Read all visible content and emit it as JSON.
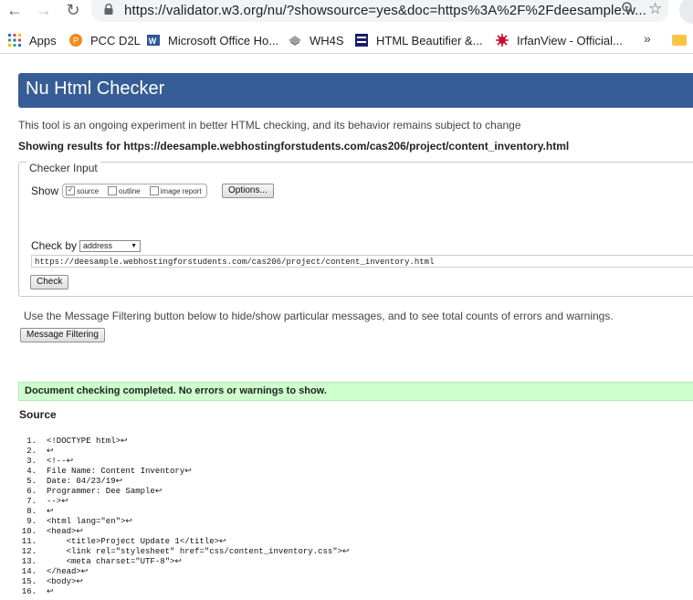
{
  "browser": {
    "url": "https://validator.w3.org/nu/?showsource=yes&doc=https%3A%2F%2Fdeesample.w...",
    "bookmarks": [
      {
        "label": "Apps",
        "icon": "apps-grid-icon"
      },
      {
        "label": "PCC D2L",
        "icon": "d2l-icon"
      },
      {
        "label": "Microsoft Office Ho...",
        "icon": "word-icon"
      },
      {
        "label": "WH4S",
        "icon": "wh4s-icon"
      },
      {
        "label": "HTML Beautifier &...",
        "icon": "tools-icon"
      },
      {
        "label": "IrfanView - Official...",
        "icon": "irfanview-icon"
      }
    ],
    "more_label": "»"
  },
  "page": {
    "title": "Nu Html Checker",
    "intro": "This tool is an ongoing experiment in better HTML checking, and its behavior remains subject to change",
    "showing_results": "Showing results for https://deesample.webhostingforstudents.com/cas206/project/content_inventory.html"
  },
  "checker_input": {
    "legend": "Checker Input",
    "show_label": "Show",
    "options": [
      {
        "label": "source",
        "checked": true
      },
      {
        "label": "outline",
        "checked": false
      },
      {
        "label": "image report",
        "checked": false
      }
    ],
    "options_button": "Options...",
    "check_by_label": "Check by",
    "check_by_value": "address",
    "doc_url": "https://deesample.webhostingforstudents.com/cas206/project/content_inventory.html",
    "check_button": "Check"
  },
  "filtering": {
    "text": "Use the Message Filtering button below to hide/show particular messages, and to see total counts of errors and warnings.",
    "button": "Message Filtering"
  },
  "result": {
    "message": "Document checking completed. No errors or warnings to show.",
    "color": "#ccffcc"
  },
  "source": {
    "title": "Source",
    "lines": [
      {
        "n": "1.",
        "code": "<!DOCTYPE html>↩"
      },
      {
        "n": "2.",
        "code": "↩"
      },
      {
        "n": "3.",
        "code": "<!--↩"
      },
      {
        "n": "4.",
        "code": "File Name: Content Inventory↩"
      },
      {
        "n": "5.",
        "code": "Date: 04/23/19↩"
      },
      {
        "n": "6.",
        "code": "Programmer: Dee Sample↩"
      },
      {
        "n": "7.",
        "code": "-->↩"
      },
      {
        "n": "8.",
        "code": "↩"
      },
      {
        "n": "9.",
        "code": "<html lang=\"en\">↩"
      },
      {
        "n": "10.",
        "code": "<head>↩"
      },
      {
        "n": "11.",
        "code": "    <title>Project Update 1</title>↩"
      },
      {
        "n": "12.",
        "code": "    <link rel=\"stylesheet\" href=\"css/content_inventory.css\">↩"
      },
      {
        "n": "13.",
        "code": "    <meta charset=\"UTF-8\">↩"
      },
      {
        "n": "14.",
        "code": "</head>↩"
      },
      {
        "n": "15.",
        "code": "<body>↩"
      },
      {
        "n": "16.",
        "code": "↩"
      }
    ]
  },
  "colors": {
    "header": "#365d95",
    "success": "#ccffcc"
  }
}
